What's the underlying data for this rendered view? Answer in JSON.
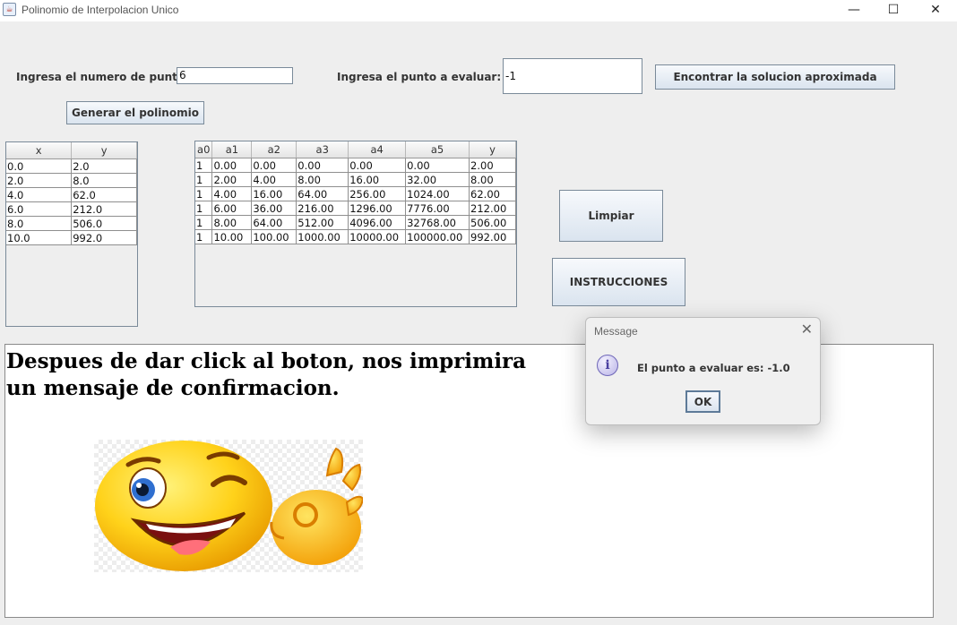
{
  "window": {
    "title": "Polinomio de Interpolacion Unico",
    "icon": "java-cup-icon",
    "controls": {
      "minimize": "—",
      "maximize": "☐",
      "close": "✕"
    }
  },
  "form": {
    "points_label": "Ingresa el numero de puntos:",
    "points_value": "6",
    "eval_label": "Ingresa el punto a evaluar:",
    "eval_value": "-1",
    "find_button": "Encontrar la solucion aproximada",
    "generate_button": "Generar el polinomio",
    "clear_button": "Limpiar",
    "instructions_button": "INSTRUCCIONES"
  },
  "points_table": {
    "columns": [
      "x",
      "y"
    ],
    "rows": [
      [
        "0.0",
        "2.0"
      ],
      [
        "2.0",
        "8.0"
      ],
      [
        "4.0",
        "62.0"
      ],
      [
        "6.0",
        "212.0"
      ],
      [
        "8.0",
        "506.0"
      ],
      [
        "10.0",
        "992.0"
      ]
    ]
  },
  "matrix_table": {
    "columns": [
      "a0",
      "a1",
      "a2",
      "a3",
      "a4",
      "a5",
      "y"
    ],
    "rows": [
      [
        "1",
        "0.00",
        "0.00",
        "0.00",
        "0.00",
        "0.00",
        "2.00"
      ],
      [
        "1",
        "2.00",
        "4.00",
        "8.00",
        "16.00",
        "32.00",
        "8.00"
      ],
      [
        "1",
        "4.00",
        "16.00",
        "64.00",
        "256.00",
        "1024.00",
        "62.00"
      ],
      [
        "1",
        "6.00",
        "36.00",
        "216.00",
        "1296.00",
        "7776.00",
        "212.00"
      ],
      [
        "1",
        "8.00",
        "64.00",
        "512.00",
        "4096.00",
        "32768.00",
        "506.00"
      ],
      [
        "1",
        "10.00",
        "100.00",
        "1000.00",
        "10000.00",
        "100000.00",
        "992.00"
      ]
    ]
  },
  "instructions_panel": {
    "text": "Despues de dar click al boton, nos imprimira un mensaje de confirmacion.",
    "image": "winking-smiley-ok-hand"
  },
  "dialog": {
    "title": "Message",
    "message": "El punto a evaluar es: -1.0",
    "ok_button": "OK",
    "icon": "info-icon",
    "close": "✕"
  }
}
